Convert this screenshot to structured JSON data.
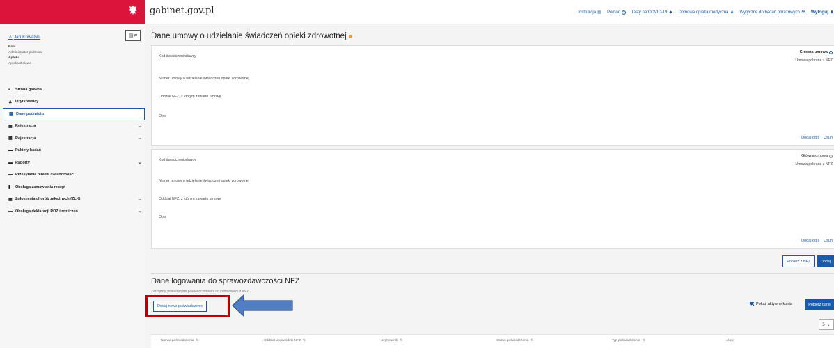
{
  "header": {
    "site_title": "gabinet.gov.pl",
    "nav": [
      {
        "label": "Instrukcja",
        "icon": "document-icon",
        "glyph": "▤"
      },
      {
        "label": "Pomoc",
        "icon": "help-icon",
        "glyph": "?"
      },
      {
        "label": "Testy na COVID-19",
        "icon": "test-tube-icon",
        "glyph": "⬥"
      },
      {
        "label": "Domowa opieka medyczna",
        "icon": "home-care-icon",
        "glyph": "♟"
      },
      {
        "label": "Wytyczne do badań obrazowych",
        "icon": "radiation-icon",
        "glyph": "☢"
      }
    ],
    "logout_label": "Wyloguj"
  },
  "sidebar": {
    "user_name": "Jan Kowalski",
    "role_key": "Rola",
    "role_value": "Administrator podmiotu",
    "pharmacy_key": "Apteka",
    "pharmacy_value": "Apteka Ziołowa",
    "items": [
      {
        "label": "Strona główna",
        "icon": "grid-icon",
        "glyph": "▪",
        "chevron": false,
        "active": false
      },
      {
        "label": "Użytkownicy",
        "icon": "user-icon",
        "glyph": "♟",
        "chevron": false,
        "active": false
      },
      {
        "label": "Dane podmiotu",
        "icon": "building-icon",
        "glyph": "▦",
        "chevron": false,
        "active": true
      },
      {
        "label": "Rejestracja",
        "icon": "calendar-icon",
        "glyph": "▦",
        "chevron": true,
        "active": false
      },
      {
        "label": "Rejestracja",
        "icon": "calendar-icon",
        "glyph": "▦",
        "chevron": true,
        "active": false
      },
      {
        "label": "Pakiety badań",
        "icon": "file-icon",
        "glyph": "▬",
        "chevron": false,
        "active": false
      },
      {
        "label": "Raporty",
        "icon": "report-icon",
        "glyph": "▬",
        "chevron": true,
        "active": false
      },
      {
        "label": "Przesyłanie plików / wiadomości",
        "icon": "file-icon",
        "glyph": "▬",
        "chevron": false,
        "active": false
      },
      {
        "label": "Obsługa zamawiania recept",
        "icon": "prescription-icon",
        "glyph": "▮",
        "chevron": false,
        "active": false
      },
      {
        "label": "Zgłoszenia chorób zakaźnych (ZLK)",
        "icon": "clipboard-icon",
        "glyph": "▦",
        "chevron": true,
        "active": false
      },
      {
        "label": "Obsługa deklaracji POZ i rozliczeń",
        "icon": "declaration-icon",
        "glyph": "▬",
        "chevron": true,
        "active": false
      }
    ]
  },
  "contract": {
    "title": "Dane umowy o udzielanie świadczeń opieki zdrowotnej",
    "fields": {
      "provider_code": "Kod świadczeniodawcy",
      "contract_number": "Numer umowy o udzielanie świadczeń opieki zdrowotnej",
      "nfz_branch": "Oddział NFZ, z którym zawarto umowę",
      "description": "Opis"
    },
    "main_contract_label": "Główna umowa",
    "downloaded_label": "Umowa pobrana z NFZ",
    "add_description": "Dodaj opis",
    "remove": "Usuń",
    "fetch_nfz": "Pobierz z NFZ",
    "add": "Dodaj"
  },
  "credentials": {
    "title": "Dane logowania do sprawozdawczości NFZ",
    "description": "Zarządzaj posiadanymi poświadczeniami do komunikacji z NFZ",
    "add_button": "Dodaj nowe poświadczenie",
    "show_active": "Pokaż aktywne konta",
    "fetch_button": "Pobierz dane",
    "page_size": "5",
    "columns": [
      "Nazwa poświadczenia",
      "Oddział wojewódzki NFZ",
      "Użytkownik",
      "Status poświadczenia",
      "Typ poświadczenia",
      "Akcje"
    ]
  },
  "colors": {
    "brand_red": "#dc143c",
    "primary_blue": "#1a5aa8",
    "highlight_red": "#c00000",
    "arrow_blue": "#4f7ec4"
  }
}
